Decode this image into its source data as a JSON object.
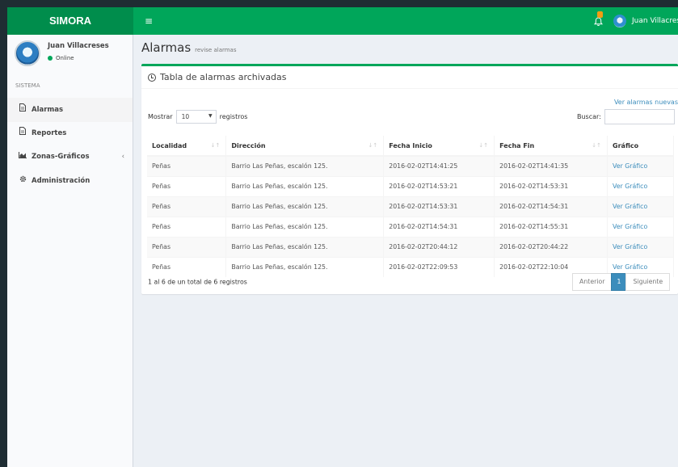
{
  "app": {
    "logo": "SIMORA"
  },
  "header": {
    "menu_icon": "hamburger-icon",
    "user_name": "Juan Villacreses"
  },
  "sidebar": {
    "user_name": "Juan Villacreses",
    "status": "Online",
    "section": "SISTEMA",
    "items": [
      {
        "label": "Alarmas",
        "icon": "file-icon",
        "active": true
      },
      {
        "label": "Reportes",
        "icon": "file-icon",
        "active": false
      },
      {
        "label": "Zonas-Gráficos",
        "icon": "area-chart-icon",
        "active": false,
        "chevron": "‹"
      },
      {
        "label": "Administración",
        "icon": "gear-icon",
        "active": false
      }
    ]
  },
  "page": {
    "title": "Alarmas",
    "subtitle": "revise alarmas"
  },
  "box": {
    "title": "Tabla de alarmas archivadas",
    "link_new": "Ver alarmas nuevas",
    "length_prefix": "Mostrar",
    "length_value": "10",
    "length_suffix": "registros",
    "search_label": "Buscar:",
    "columns": [
      "Localidad",
      "Dirección",
      "Fecha Inicio",
      "Fecha Fin",
      "Gráfico"
    ],
    "rows": [
      [
        "Peñas",
        "Barrio Las Peñas, escalón 125.",
        "2016-02-02T14:41:25",
        "2016-02-02T14:41:35",
        "Ver Gráfico"
      ],
      [
        "Peñas",
        "Barrio Las Peñas, escalón 125.",
        "2016-02-02T14:53:21",
        "2016-02-02T14:53:31",
        "Ver Gráfico"
      ],
      [
        "Peñas",
        "Barrio Las Peñas, escalón 125.",
        "2016-02-02T14:53:31",
        "2016-02-02T14:54:31",
        "Ver Gráfico"
      ],
      [
        "Peñas",
        "Barrio Las Peñas, escalón 125.",
        "2016-02-02T14:54:31",
        "2016-02-02T14:55:31",
        "Ver Gráfico"
      ],
      [
        "Peñas",
        "Barrio Las Peñas, escalón 125.",
        "2016-02-02T20:44:12",
        "2016-02-02T20:44:22",
        "Ver Gráfico"
      ],
      [
        "Peñas",
        "Barrio Las Peñas, escalón 125.",
        "2016-02-02T22:09:53",
        "2016-02-02T22:10:04",
        "Ver Gráfico"
      ]
    ],
    "info": "1 al 6 de un total de 6 registros",
    "pager": {
      "prev": "Anterior",
      "page": "1",
      "next": "Siguiente"
    }
  },
  "colors": {
    "header": "#00a65a",
    "logo_bg": "#008d4c",
    "link": "#3c8dbc",
    "notification": "#f39c12"
  }
}
